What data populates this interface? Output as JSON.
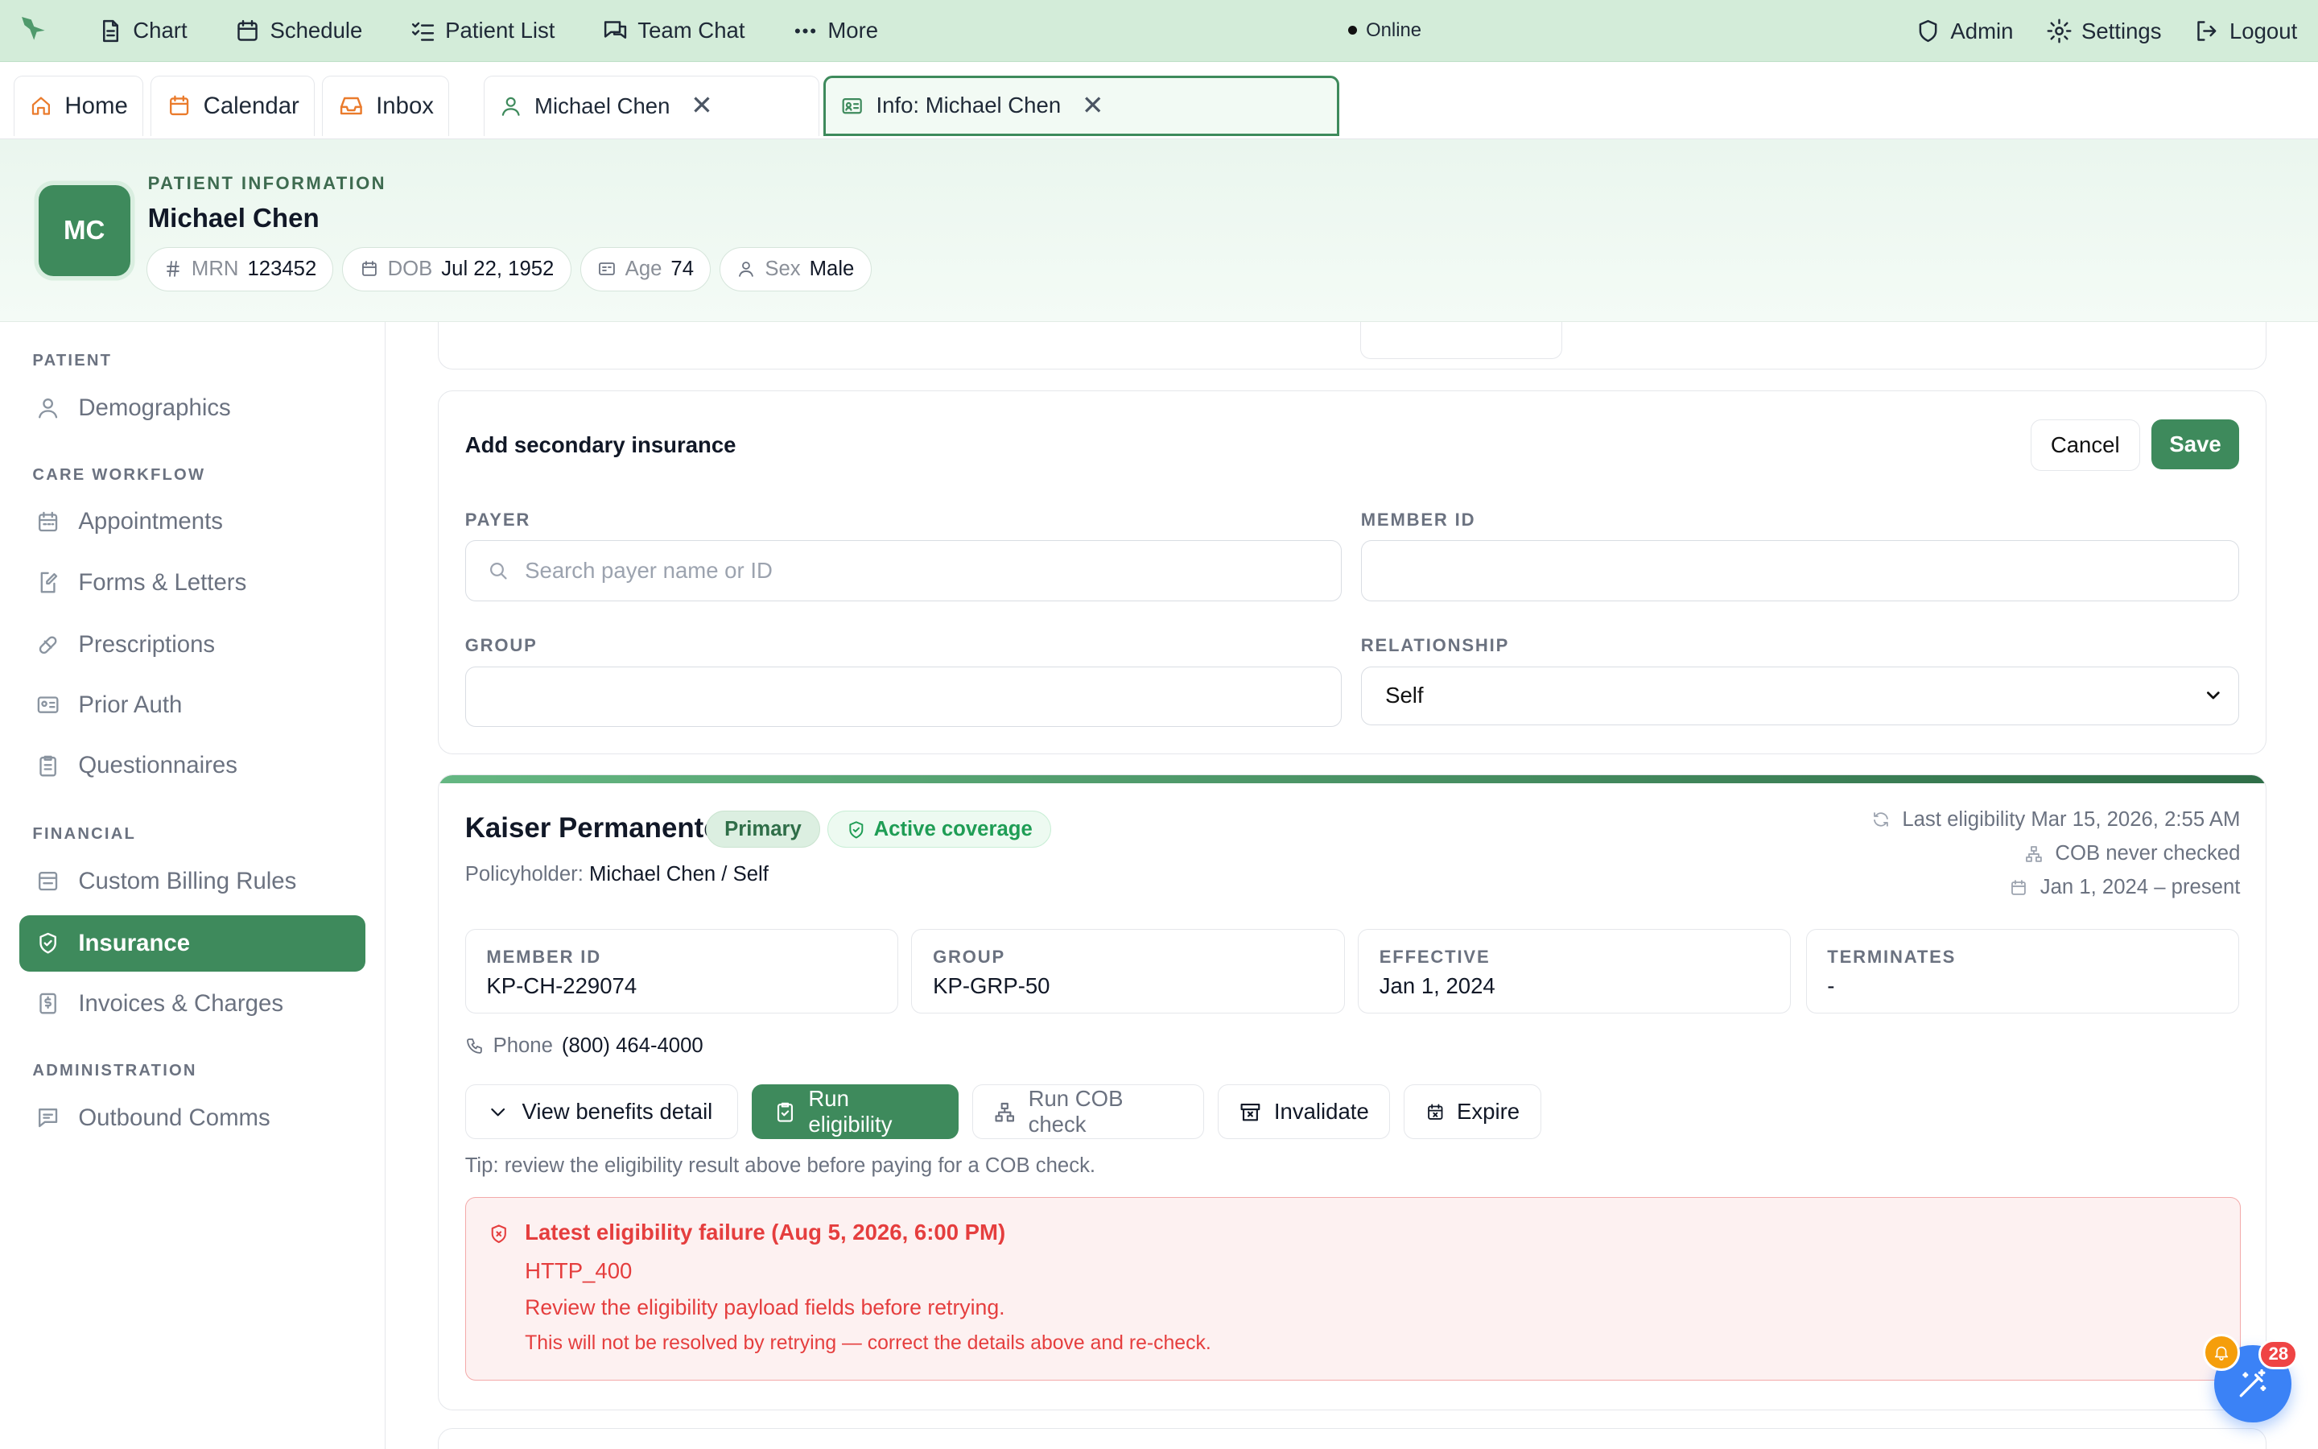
{
  "topnav": {
    "items": [
      {
        "label": "Chart",
        "icon": "file-text-icon"
      },
      {
        "label": "Schedule",
        "icon": "calendar-icon"
      },
      {
        "label": "Patient List",
        "icon": "list-check-icon"
      },
      {
        "label": "Team Chat",
        "icon": "chat-icon"
      },
      {
        "label": "More",
        "icon": "dots-icon"
      }
    ],
    "status": "Online",
    "right": [
      {
        "label": "Admin",
        "icon": "shield-icon"
      },
      {
        "label": "Settings",
        "icon": "gear-icon"
      },
      {
        "label": "Logout",
        "icon": "logout-icon"
      }
    ]
  },
  "tabs": [
    {
      "label": "Home",
      "icon": "home-icon"
    },
    {
      "label": "Calendar",
      "icon": "calendar-icon"
    },
    {
      "label": "Inbox",
      "icon": "inbox-icon"
    },
    {
      "label": "Michael Chen",
      "icon": "user-icon"
    },
    {
      "label": "Info: Michael Chen",
      "icon": "id-card-icon"
    }
  ],
  "patient": {
    "section_label": "PATIENT INFORMATION",
    "initials": "MC",
    "name": "Michael Chen",
    "chips": [
      {
        "key": "MRN",
        "value": "123452",
        "icon": "hash-icon"
      },
      {
        "key": "DOB",
        "value": "Jul 22, 1952",
        "icon": "calendar-icon"
      },
      {
        "key": "Age",
        "value": "74",
        "icon": "id-card-icon"
      },
      {
        "key": "Sex",
        "value": "Male",
        "icon": "user-icon"
      }
    ]
  },
  "sidebar": {
    "sections": [
      "PATIENT",
      "CARE WORKFLOW",
      "FINANCIAL",
      "ADMINISTRATION"
    ],
    "items": [
      {
        "label": "Demographics",
        "icon": "user-icon"
      },
      {
        "label": "Appointments",
        "icon": "calendar-icon"
      },
      {
        "label": "Forms & Letters",
        "icon": "edit-doc-icon"
      },
      {
        "label": "Prescriptions",
        "icon": "pill-icon"
      },
      {
        "label": "Prior Auth",
        "icon": "id-card-icon"
      },
      {
        "label": "Questionnaires",
        "icon": "clipboard-icon"
      },
      {
        "label": "Custom Billing Rules",
        "icon": "billing-icon"
      },
      {
        "label": "Insurance",
        "icon": "shield-check-icon"
      },
      {
        "label": "Invoices & Charges",
        "icon": "dollar-doc-icon"
      },
      {
        "label": "Outbound Comms",
        "icon": "message-icon"
      }
    ]
  },
  "secondary_form": {
    "title": "Add secondary insurance",
    "cancel": "Cancel",
    "save": "Save",
    "payer_label": "PAYER",
    "payer_placeholder": "Search payer name or ID",
    "member_label": "MEMBER ID",
    "member_value": "",
    "group_label": "GROUP",
    "group_value": "",
    "relationship_label": "RELATIONSHIP",
    "relationship_value": "Self"
  },
  "coverage": {
    "payer": "Kaiser Permanente",
    "badge_primary": "Primary",
    "badge_status": "Active coverage",
    "policyholder_label": "Policyholder:",
    "policyholder_value": "Michael Chen / Self",
    "last_eligibility": "Last eligibility Mar 15, 2026, 2:55 AM",
    "cob_status": "COB never checked",
    "date_range": "Jan 1, 2024 – present",
    "fields": [
      {
        "label": "MEMBER ID",
        "value": "KP-CH-229074"
      },
      {
        "label": "GROUP",
        "value": "KP-GRP-50"
      },
      {
        "label": "EFFECTIVE",
        "value": "Jan 1, 2024"
      },
      {
        "label": "TERMINATES",
        "value": "-"
      }
    ],
    "phone_label": "Phone",
    "phone_value": "(800) 464-4000",
    "actions": {
      "benefits": "View benefits detail",
      "eligibility": "Run eligibility",
      "cob": "Run COB check",
      "invalidate": "Invalidate",
      "expire": "Expire"
    },
    "tip": "Tip: review the eligibility result above before paying for a COB check.",
    "error": {
      "title": "Latest eligibility failure (Aug 5, 2026, 6:00 PM)",
      "code": "HTTP_400",
      "message": "Review the eligibility payload fields before retrying.",
      "note": "This will not be resolved by retrying — correct the details above and re-check."
    }
  },
  "notifications": {
    "count": "28"
  },
  "colors": {
    "brand": "#3e8a5c",
    "error": "#e53e3e",
    "fab": "#3b82f6"
  }
}
